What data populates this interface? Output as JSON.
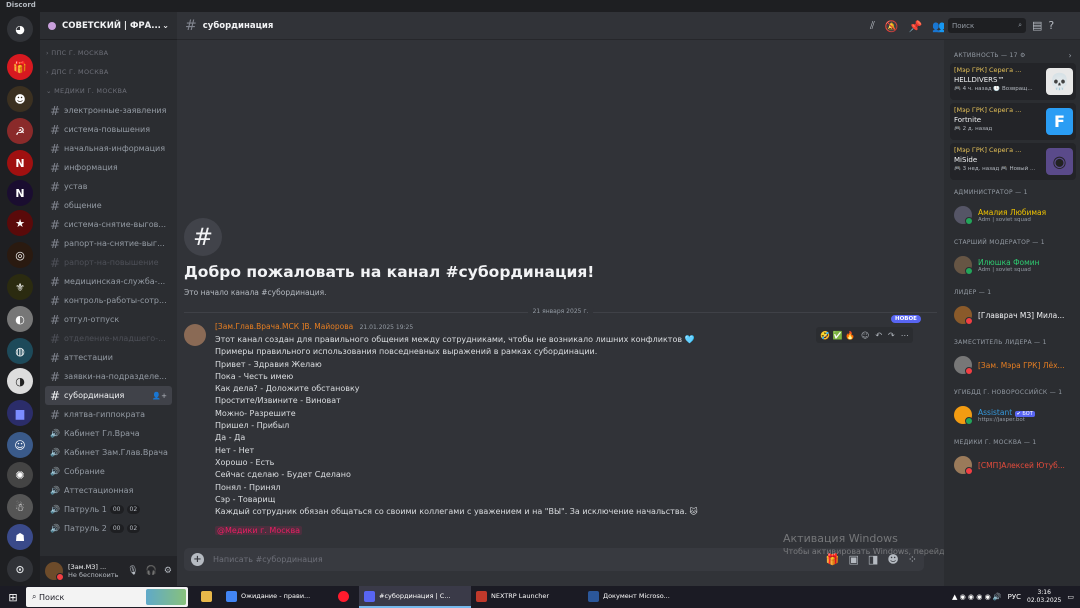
{
  "app": {
    "title": "Discord"
  },
  "colors": {
    "accent": "#5865f2",
    "bg_main": "#313338",
    "sidebar": "#2b2d31",
    "rail": "#1e1f22",
    "author": "#e67e22",
    "mention": "#e91e63"
  },
  "guild": {
    "name": "СОВЕТСКИЙ | ФРА..."
  },
  "categories": {
    "c1": "ППС Г. МОСКВА",
    "c2": "ДПС Г. МОСКВА",
    "c3": "МЕДИКИ Г. МОСКВА"
  },
  "channels": [
    {
      "name": "электронные-заявления",
      "state": "normal"
    },
    {
      "name": "система-повышения",
      "state": "normal"
    },
    {
      "name": "начальная-информация",
      "state": "normal"
    },
    {
      "name": "информация",
      "state": "normal"
    },
    {
      "name": "устав",
      "state": "normal"
    },
    {
      "name": "общение",
      "state": "normal"
    },
    {
      "name": "система-снятие-выгов...",
      "state": "normal"
    },
    {
      "name": "рапорт-на-снятие-выг...",
      "state": "normal"
    },
    {
      "name": "рапорт-на-повышение",
      "state": "muted"
    },
    {
      "name": "медицинская-служба-...",
      "state": "normal"
    },
    {
      "name": "контроль-работы-сотр...",
      "state": "normal"
    },
    {
      "name": "отгул-отпуск",
      "state": "normal"
    },
    {
      "name": "отделение-младшего-...",
      "state": "muted"
    },
    {
      "name": "аттестации",
      "state": "normal"
    },
    {
      "name": "заявки-на-подразделе...",
      "state": "normal"
    },
    {
      "name": "субординация",
      "state": "active"
    },
    {
      "name": "клятва-гиппократа",
      "state": "normal"
    },
    {
      "name": "Кабинет Гл.Врача",
      "state": "voice"
    },
    {
      "name": "Кабинет Зам.Глав.Врача",
      "state": "voice"
    },
    {
      "name": "Собрание",
      "state": "voice"
    },
    {
      "name": "Аттестационная",
      "state": "voice"
    },
    {
      "name": "Патруль 1",
      "state": "voice",
      "p1": "00",
      "p2": "02"
    },
    {
      "name": "Патруль 2",
      "state": "voice",
      "p1": "00",
      "p2": "02"
    }
  ],
  "user_panel": {
    "name": "[Зам.МЗ] ...",
    "status": "Не беспокоить"
  },
  "channel": {
    "name": "субординация",
    "welcome_title": "Добро пожаловать на канал #субординация!",
    "welcome_sub": "Это начало канала #субординация."
  },
  "search": {
    "placeholder": "Поиск"
  },
  "divider_date": "21 января 2025 г.",
  "message": {
    "author": "[Зам.Глав.Врача.МСК ]В. Майорова",
    "timestamp": "21.01.2025 19:25",
    "lines": [
      "Этот канал создан для правильного общения между сотрудниками, чтобы не возникало лишних конфликтов 🩵",
      "Примеры правильного использования повседневных выражений в рамках субординации.",
      "Привет - Здравия Желаю",
      "Пока - Честь имею",
      "Как дела? - Доложите обстановку",
      "Простите/Извините - Виноват",
      "Можно- Разрешите",
      "Пришел - Прибыл",
      "Да - Да",
      "Нет - Нет",
      "Хорошо - Есть",
      "Сейчас сделаю - Будет Сделано",
      "Понял - Принял",
      "Сэр - Товарищ",
      "Каждый сотрудник обязан общаться со своими коллегами с уважением и на \"ВЫ\". За исключение начальства. 🐱"
    ],
    "mention": "@Медики г. Москва",
    "new_badge": "НОВОЕ",
    "reactions": "🤣 ✅ 🔥"
  },
  "composer": {
    "placeholder": "Написать #субординация"
  },
  "watermark": {
    "line1": "Активация Windows",
    "line2": "Чтобы активировать Windows, перейдите в раздел \"Параметры\"."
  },
  "members": {
    "activity_header": "АКТИВНОСТЬ — 17",
    "activities": [
      {
        "user": "[Мэр ГРК] Серега ...",
        "game": "HELLDIVERS™",
        "meta": "🎮 4 ч. назад  🕒 Возвращ...",
        "color": "#e8e8e8",
        "glyph": "💀"
      },
      {
        "user": "[Мэр ГРК] Серега ...",
        "game": "Fortnite",
        "meta": "🎮 2 д. назад",
        "color": "#2a9df4",
        "glyph": "F"
      },
      {
        "user": "[Мэр ГРК] Серега ...",
        "game": "MiSide",
        "meta": "🎮 3 нед. назад  🎮 Новый ...",
        "color": "#5a4a8a",
        "glyph": "◉"
      }
    ],
    "groups": [
      {
        "header": "АДМИНИСТРАТОР — 1",
        "name": "Амалия Любимая",
        "status": "Adm | soviet squad",
        "color": "#f0c400",
        "av": "#556",
        "presence": "online"
      },
      {
        "header": "СТАРШИЙ МОДЕРАТОР — 1",
        "name": "Илюшка Фомин",
        "status": "Adm | soviet squad",
        "color": "#2ecc71",
        "av": "#665544",
        "presence": "online"
      },
      {
        "header": "ЛИДЕР — 1",
        "name": "[Главврач МЗ] Мила...",
        "status": "",
        "color": "#f2f3f5",
        "av": "#8a5a2a",
        "presence": "dnd"
      },
      {
        "header": "ЗАМЕСТИТЕЛЬ ЛИДЕРА — 1",
        "name": "[Зам. Мэра ГРК] Лёх...",
        "status": "",
        "color": "#e67e22",
        "av": "#777",
        "presence": "dnd"
      },
      {
        "header": "УГИБДД Г. НОВОРОССИЙСК — 1",
        "name": "Assistant",
        "status": "https://jasper.bot",
        "color": "#3498db",
        "av": "#f39c12",
        "presence": "online",
        "bot": "✔ БОТ"
      },
      {
        "header": "МЕДИКИ Г. МОСКВА — 1",
        "name": "[СМП]Алексей Ютуб...",
        "status": "",
        "color": "#e74c3c",
        "av": "#9a7a5a",
        "presence": "dnd"
      }
    ]
  },
  "taskbar": {
    "search": "Поиск",
    "apps": [
      {
        "label": "Ожидание - прави...",
        "color": "#4285f4",
        "active": false
      },
      {
        "label": "",
        "color": "#ff1b2d",
        "active": false
      },
      {
        "label": "#субординация | С...",
        "color": "#5865f2",
        "active": true
      },
      {
        "label": "NEXTRP Launcher",
        "color": "#c0392b",
        "active": false
      },
      {
        "label": "Документ Microso...",
        "color": "#2b579a",
        "active": false
      }
    ],
    "lang": "РУС",
    "time": "3:16",
    "date": "02.03.2025"
  }
}
